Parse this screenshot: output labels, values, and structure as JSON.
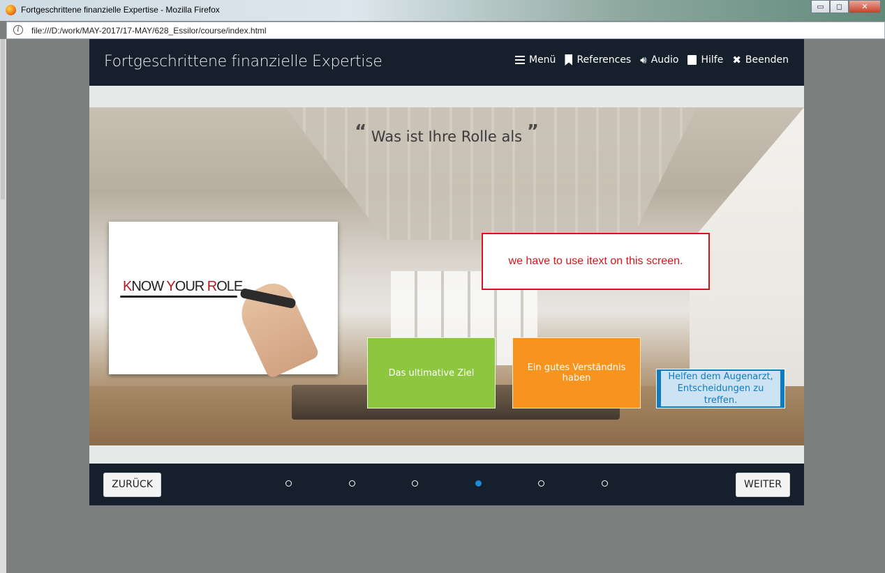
{
  "window": {
    "title": "Fortgeschrittene finanzielle Expertise - Mozilla Firefox",
    "url": "file:///D:/work/MAY-2017/17-MAY/628_Essilor/course/index.html",
    "buttons": {
      "minimize": "▭",
      "maximize": "◻",
      "close": "✕"
    }
  },
  "course": {
    "title": "Fortgeschrittene finanzielle Expertise",
    "nav": [
      {
        "label": "Menü",
        "icon": "menu-icon"
      },
      {
        "label": "References",
        "icon": "bookmark-icon"
      },
      {
        "label": "Audio",
        "icon": "speaker-icon"
      },
      {
        "label": "Hilfe",
        "icon": "book-icon"
      },
      {
        "label": "Beenden",
        "icon": "close-icon"
      }
    ],
    "slide": {
      "question": "Was ist Ihre Rolle als",
      "card_text": [
        "K",
        "NOW ",
        "Y",
        "OUR ",
        "R",
        "OLE"
      ],
      "note": "we have to use itext on this screen.",
      "options": [
        {
          "label": "Das ultimative Ziel",
          "color": "#8dc63f"
        },
        {
          "label": "Ein gutes Verständnis haben",
          "color": "#f7941d"
        },
        {
          "label": "Helfen dem Augenarzt, Entscheidungen zu treffen.",
          "color": "#0f7cc0"
        }
      ]
    },
    "footer": {
      "back": "ZURÜCK",
      "next": "WEITER",
      "page_count": 6,
      "active_page": 4
    }
  },
  "colors": {
    "header": "#16202c",
    "accent": "#1d8ad8",
    "note_border": "#d4151c"
  }
}
